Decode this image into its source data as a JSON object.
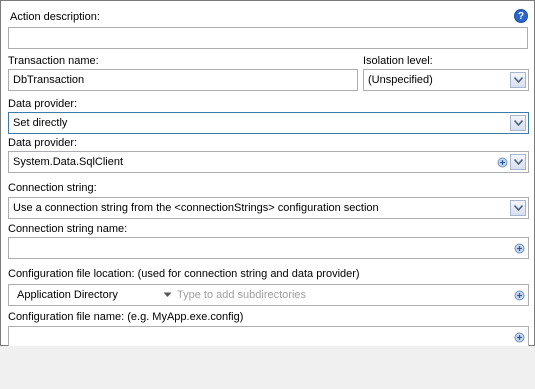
{
  "action_description": {
    "label": "Action description:",
    "value": ""
  },
  "transaction_name": {
    "label": "Transaction name:",
    "value": "DbTransaction"
  },
  "isolation_level": {
    "label": "Isolation level:",
    "value": "(Unspecified)"
  },
  "data_provider_mode": {
    "label": "Data provider:",
    "value": "Set directly"
  },
  "data_provider": {
    "label": "Data provider:",
    "value": "System.Data.SqlClient"
  },
  "connection_string": {
    "label": "Connection string:",
    "value": "Use a connection string from the  <connectionStrings> configuration section"
  },
  "connection_string_name": {
    "label": "Connection string name:",
    "value": ""
  },
  "config_file_location": {
    "label": "Configuration file location: (used for connection string and data provider)",
    "value": "Application Directory",
    "subdir_placeholder": "Type to add subdirectories"
  },
  "config_file_name": {
    "label": "Configuration file name: (e.g. MyApp.exe.config)",
    "value": ""
  },
  "icons": {
    "help": "help-icon",
    "dropdown": "chevron-down-icon",
    "variable": "add-variable-icon"
  },
  "help_glyph": "?"
}
